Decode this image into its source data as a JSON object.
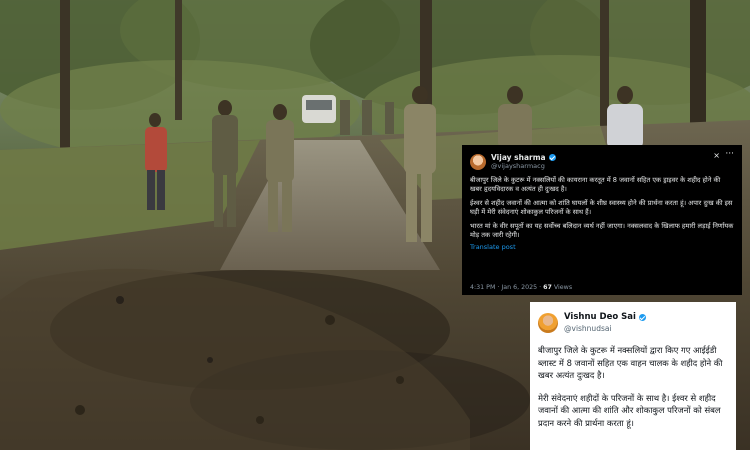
{
  "photo": {
    "description_icon": "forest-road-scene"
  },
  "tweet_dark": {
    "name": "Vijay sharma",
    "handle": "@vijaysharmacg",
    "close": "×",
    "more": "···",
    "paragraphs": [
      "बीजापुर जिले के कुटरू में नक्सलियों की कायराना करतूत में 8 जवानों सहित एक ड्राइवर के शहीद होने की खबर हृदयविदारक व अत्यंत ही दुःखद है।",
      "ईश्वर से शहीद जवानों की आत्मा को शांति घायलों के शीघ्र स्वास्थ्य होने की प्रार्थना करता हूं। अपार दुःख की इस घड़ी में मेरी संवेदनाएं शोकाकुल परिजनों के साथ हैं।",
      "भारत मां के वीर सपूतों का यह सर्वोच्च बलिदान व्यर्थ नहीं जाएगा। नक्सलवाद के खिलाफ हमारी लड़ाई निर्णायक मोड़ तक जारी रहेगी।"
    ],
    "translate": "Translate post",
    "time": "4:31 PM · Jan 6, 2025 · ",
    "views": "67",
    "views_label": " Views",
    "colors": {
      "bg": "#000000",
      "text": "#e7e9ea",
      "muted": "#8b98a5",
      "link": "#1d9bf0"
    }
  },
  "tweet_light": {
    "name": "Vishnu Deo Sai",
    "handle": "@vishnudsai",
    "paragraphs": [
      "बीजापुर जिले के कुटरू में नक्सलियों द्वारा किए गए आईईडी ब्लास्ट में 8 जवानों सहित एक वाहन चालक के शहीद होने की खबर अत्यंत दुःखद है।",
      "मेरी संवेदनाएं शहीदों के परिजनों के साथ है। ईश्वर से शहीद जवानों की आत्मा की शांति और शोकाकुल परिजनों को संबल प्रदान करने की प्रार्थना करता हूं।"
    ],
    "colors": {
      "bg": "#ffffff",
      "text": "#0f1419",
      "muted": "#536471",
      "verified": "#1d9bf0"
    }
  }
}
